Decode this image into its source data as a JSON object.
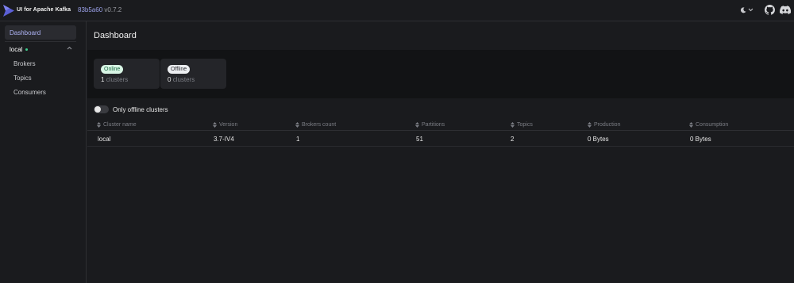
{
  "header": {
    "brand": "UI for Apache Kafka",
    "commit": "83b5a60",
    "version": "v0.7.2",
    "accent": "#5b5fd6"
  },
  "sidebar": {
    "dashboard_label": "Dashboard",
    "cluster_name": "local",
    "cluster_status_color": "#3ecf8e",
    "items": [
      {
        "label": "Brokers"
      },
      {
        "label": "Topics"
      },
      {
        "label": "Consumers"
      }
    ]
  },
  "main": {
    "title": "Dashboard",
    "stats": [
      {
        "badge": "Online",
        "count": "1",
        "unit": "clusters"
      },
      {
        "badge": "Offline",
        "count": "0",
        "unit": "clusters"
      }
    ],
    "toggle_label": "Only offline clusters",
    "table": {
      "columns": [
        "Cluster name",
        "Version",
        "Brokers count",
        "Partitions",
        "Topics",
        "Production",
        "Consumption"
      ],
      "rows": [
        [
          "local",
          "3.7-IV4",
          "1",
          "51",
          "2",
          "0 Bytes",
          "0 Bytes"
        ]
      ]
    }
  }
}
